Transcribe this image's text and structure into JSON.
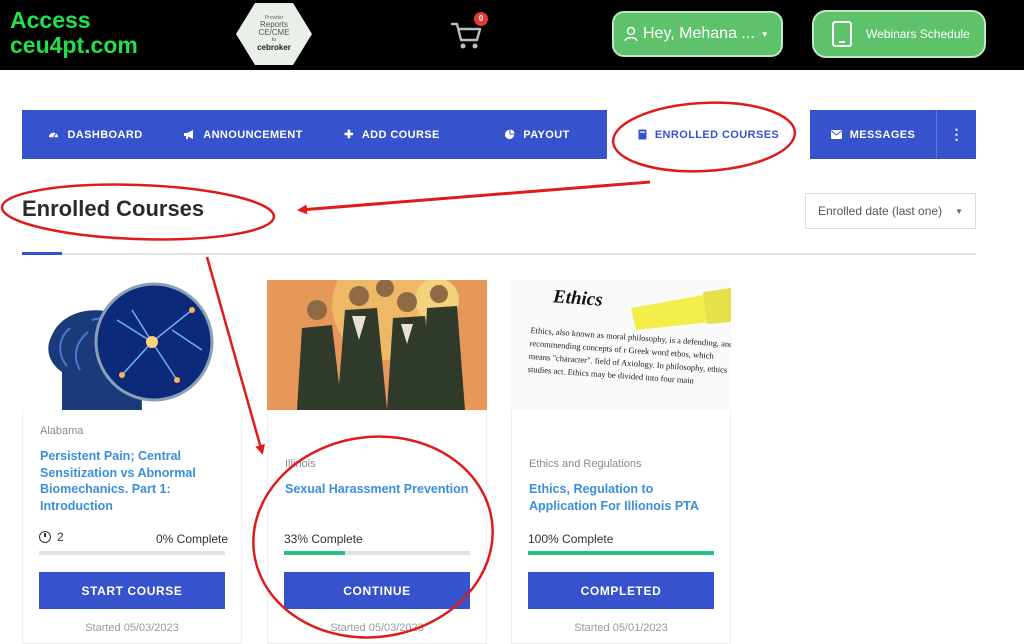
{
  "header": {
    "brand_line1": "Access",
    "brand_line2": "ceu4pt.com",
    "badge": {
      "line1": "Provider",
      "line2": "Reports",
      "line3": "CE/CME",
      "line4": "to",
      "line5": "cebroker"
    },
    "cart_count": "0",
    "user_label": "Hey, Mehana ...",
    "webinars_label": "Webinars Schedule"
  },
  "nav": {
    "items": [
      {
        "label": "DASHBOARD",
        "icon": "dashboard-icon"
      },
      {
        "label": "ANNOUNCEMENT",
        "icon": "megaphone-icon"
      },
      {
        "label": "ADD COURSE",
        "icon": "plus-icon"
      },
      {
        "label": "PAYOUT",
        "icon": "pie-chart-icon"
      },
      {
        "label": "ENROLLED COURSES",
        "icon": "book-icon",
        "active": true
      },
      {
        "label": "MESSAGES",
        "icon": "envelope-icon"
      }
    ],
    "more_icon": "kebab-menu-icon"
  },
  "page": {
    "title": "Enrolled Courses",
    "sort_selected": "Enrolled date (last one)"
  },
  "courses": [
    {
      "category": "Alabama",
      "title": "Persistent Pain; Central Sensitization vs Abnormal Biomechanics. Part 1: Introduction",
      "lessons": "2",
      "progress_label": "0% Complete",
      "progress": 0,
      "action": "START COURSE",
      "started": "Started 05/03/2023"
    },
    {
      "category": "Illinois",
      "title": "Sexual Harassment Prevention",
      "progress_label": "33% Complete",
      "progress": 33,
      "action": "CONTINUE",
      "started": "Started 05/03/2023"
    },
    {
      "category": "Ethics and Regulations",
      "title": "Ethics, Regulation to Application For Illionois PTA",
      "progress_label": "100% Complete",
      "progress": 100,
      "action": "COMPLETED",
      "started": "Started 05/01/2023",
      "thumb_heading": "Ethics",
      "thumb_text": "Ethics, also known as moral philosophy, is a defending, and recommending concepts of r Greek word ethos, which means \"character\". field of Axiology. In philosophy, ethics studies act. Ethics may be divided into four main"
    }
  ],
  "colors": {
    "brand_green": "#22e04a",
    "nav_blue": "#3652cc",
    "link_blue": "#3a8fd8",
    "progress_green": "#26c281",
    "button_green": "#5ec26a",
    "annotation_red": "#e01b1b"
  }
}
